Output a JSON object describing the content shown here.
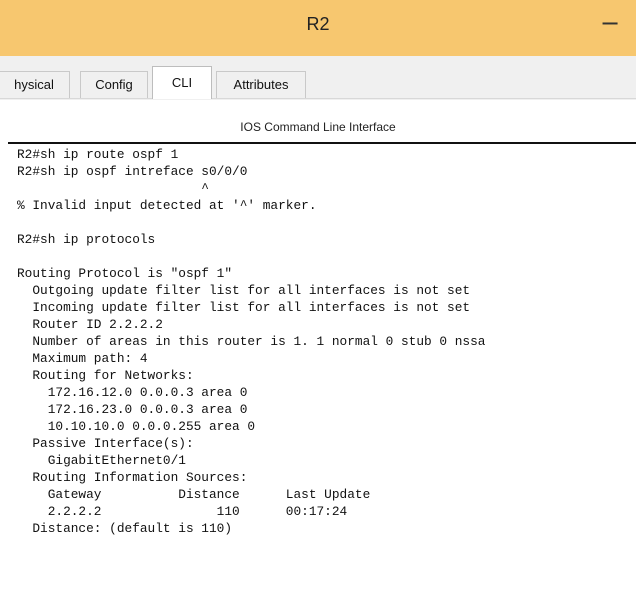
{
  "window": {
    "title": "R2",
    "minimize_symbol": "−"
  },
  "tabs": [
    {
      "label": "hysical",
      "active": false
    },
    {
      "label": "Config",
      "active": false
    },
    {
      "label": "CLI",
      "active": true
    },
    {
      "label": "Attributes",
      "active": false
    }
  ],
  "cli": {
    "section_title": "IOS Command Line Interface",
    "lines": [
      "R2#sh ip route ospf 1",
      "R2#sh ip ospf intreface s0/0/0",
      "                        ^",
      "% Invalid input detected at '^' marker.",
      "",
      "R2#sh ip protocols",
      "",
      "Routing Protocol is \"ospf 1\"",
      "  Outgoing update filter list for all interfaces is not set",
      "  Incoming update filter list for all interfaces is not set",
      "  Router ID 2.2.2.2",
      "  Number of areas in this router is 1. 1 normal 0 stub 0 nssa",
      "  Maximum path: 4",
      "  Routing for Networks:",
      "    172.16.12.0 0.0.0.3 area 0",
      "    172.16.23.0 0.0.0.3 area 0",
      "    10.10.10.0 0.0.0.255 area 0",
      "  Passive Interface(s):",
      "    GigabitEthernet0/1",
      "  Routing Information Sources:",
      "    Gateway          Distance      Last Update",
      "    2.2.2.2               110      00:17:24",
      "  Distance: (default is 110)"
    ]
  },
  "colors": {
    "titlebar": "#f7c76f",
    "tabbar": "#f0f0f0",
    "text": "#111111"
  }
}
